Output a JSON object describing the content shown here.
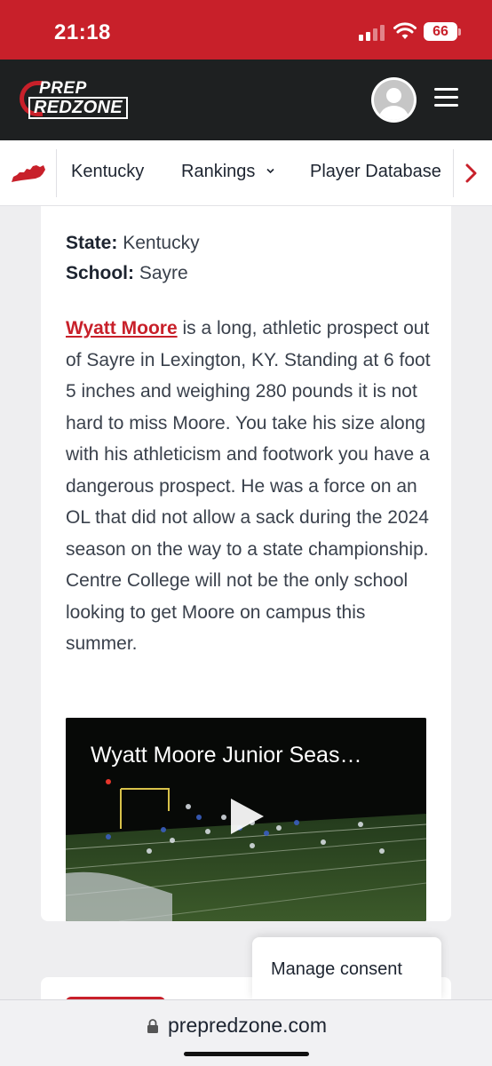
{
  "status_bar": {
    "time": "21:18",
    "battery": "66",
    "icons": [
      "signal-icon",
      "wifi-icon",
      "battery-icon"
    ]
  },
  "header": {
    "logo_line1": "PREP",
    "logo_line2": "REDZONE",
    "icons": [
      "avatar-icon",
      "hamburger-menu-icon"
    ]
  },
  "nav": {
    "state_icon": "kentucky-state-icon",
    "items": [
      {
        "label": "Kentucky"
      },
      {
        "label": "Rankings"
      },
      {
        "label": "Player Database"
      }
    ],
    "next_icon": "chevron-right-icon",
    "dropdown_icon": "chevron-down-icon"
  },
  "profile": {
    "state_label": "State:",
    "state_value": "Kentucky",
    "school_label": "School:",
    "school_value": "Sayre"
  },
  "article": {
    "player_link": "Wyatt Moore",
    "body": " is a long, athletic prospect out of Sayre in Lexington, KY. Standing at 6 foot 5 inches and weighing 280 pounds it is not hard to miss Moore. You take his size along with his athleticism and footwork you have a dangerous prospect. He was a force on an OL that did not allow a sack during the 2024 season on the way to a state championship. Centre College will not be the only school looking to get Moore on campus this summer."
  },
  "video": {
    "title": "Wyatt Moore Junior Seas…",
    "play_icon": "play-icon"
  },
  "consent": {
    "label": "Manage consent"
  },
  "browser": {
    "url": "prepredzone.com",
    "lock_icon": "lock-icon"
  },
  "colors": {
    "brand_red": "#c8202a",
    "header_dark": "#1e2021",
    "page_bg": "#eeeef0"
  }
}
